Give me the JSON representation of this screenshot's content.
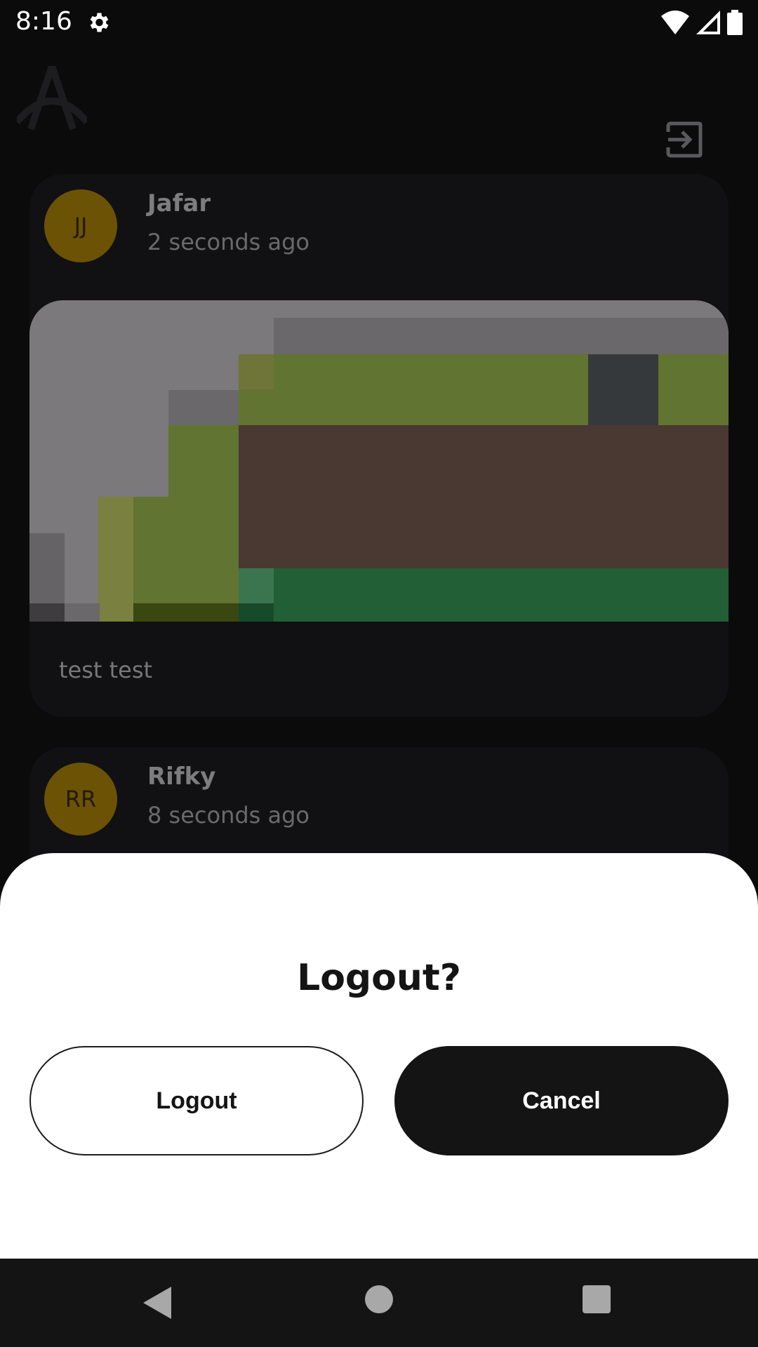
{
  "status_bar": {
    "time": "8:16"
  },
  "posts": [
    {
      "initials": "JJ",
      "name": "Jafar",
      "time": "2 seconds ago",
      "caption": "test test"
    },
    {
      "initials": "RR",
      "name": "Rifky",
      "time": "8 seconds ago"
    }
  ],
  "dialog": {
    "title": "Logout?",
    "logout_label": "Logout",
    "cancel_label": "Cancel"
  },
  "colors": {
    "avatar": "#6b5205",
    "sheet": "#ffffff",
    "primary_button": "#141414"
  },
  "icons": [
    "settings-icon",
    "wifi-icon",
    "signal-icon",
    "battery-icon",
    "app-logo",
    "logout-icon",
    "back-icon",
    "home-icon",
    "recents-icon"
  ]
}
